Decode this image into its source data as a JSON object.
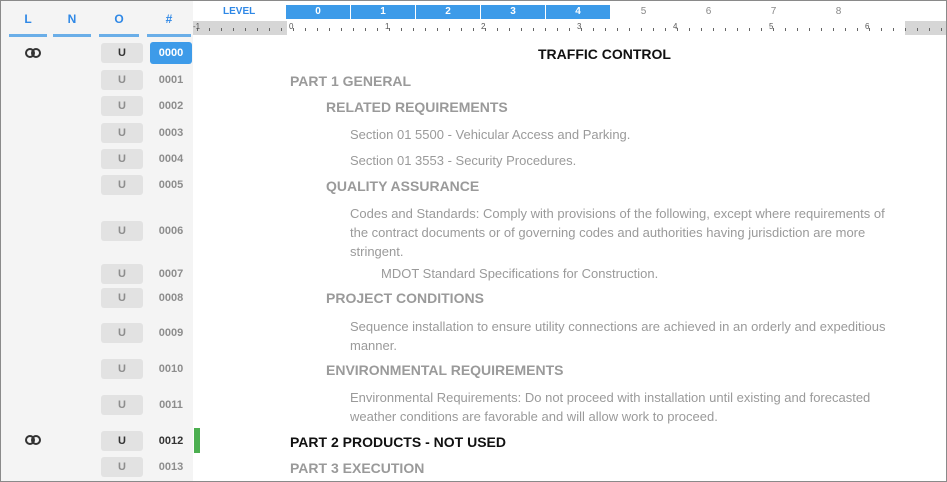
{
  "columns": {
    "l": "L",
    "n": "N",
    "o": "O",
    "num": "#"
  },
  "ruler": {
    "level_label": "LEVEL",
    "levels": [
      "0",
      "1",
      "2",
      "3",
      "4",
      "5",
      "6",
      "7",
      "8"
    ],
    "active_levels": 5,
    "numbers": [
      "-1",
      "0",
      "1",
      "2",
      "3",
      "4",
      "5",
      "6"
    ]
  },
  "rows": [
    {
      "o": "U",
      "num": "0000",
      "text": "TRAFFIC CONTROL"
    },
    {
      "o": "U",
      "num": "0001",
      "text": "PART 1 GENERAL"
    },
    {
      "o": "U",
      "num": "0002",
      "text": "RELATED REQUIREMENTS"
    },
    {
      "o": "U",
      "num": "0003",
      "text": "Section 01 5500 - Vehicular Access and Parking."
    },
    {
      "o": "U",
      "num": "0004",
      "text": "Section 01 3553 - Security Procedures."
    },
    {
      "o": "U",
      "num": "0005",
      "text": "QUALITY ASSURANCE"
    },
    {
      "o": "U",
      "num": "0006",
      "text_lines": [
        "Codes and Standards:  Comply with provisions of the following, except where requirements of",
        "the contract documents or of governing codes and authorities having jurisdiction are more",
        "stringent."
      ]
    },
    {
      "o": "U",
      "num": "0007",
      "text": "MDOT Standard Specifications for Construction."
    },
    {
      "o": "U",
      "num": "0008",
      "text": "PROJECT CONDITIONS"
    },
    {
      "o": "U",
      "num": "0009",
      "text_lines": [
        "Sequence installation to ensure utility connections are achieved in an orderly and expeditious",
        "manner."
      ]
    },
    {
      "o": "U",
      "num": "0010",
      "text": "ENVIRONMENTAL REQUIREMENTS"
    },
    {
      "o": "U",
      "num": "0011",
      "text_lines": [
        "Environmental Requirements:  Do not proceed with installation until existing and forecasted",
        "weather conditions are favorable and will allow work to proceed."
      ]
    },
    {
      "o": "U",
      "num": "0012",
      "text": "PART 2 PRODUCTS - NOT USED"
    },
    {
      "o": "U",
      "num": "0013",
      "text": "PART 3 EXECUTION"
    }
  ],
  "colors": {
    "accent": "#3d9be9",
    "green_marker": "#4caf50"
  },
  "icons": {
    "link": "link-icon"
  }
}
